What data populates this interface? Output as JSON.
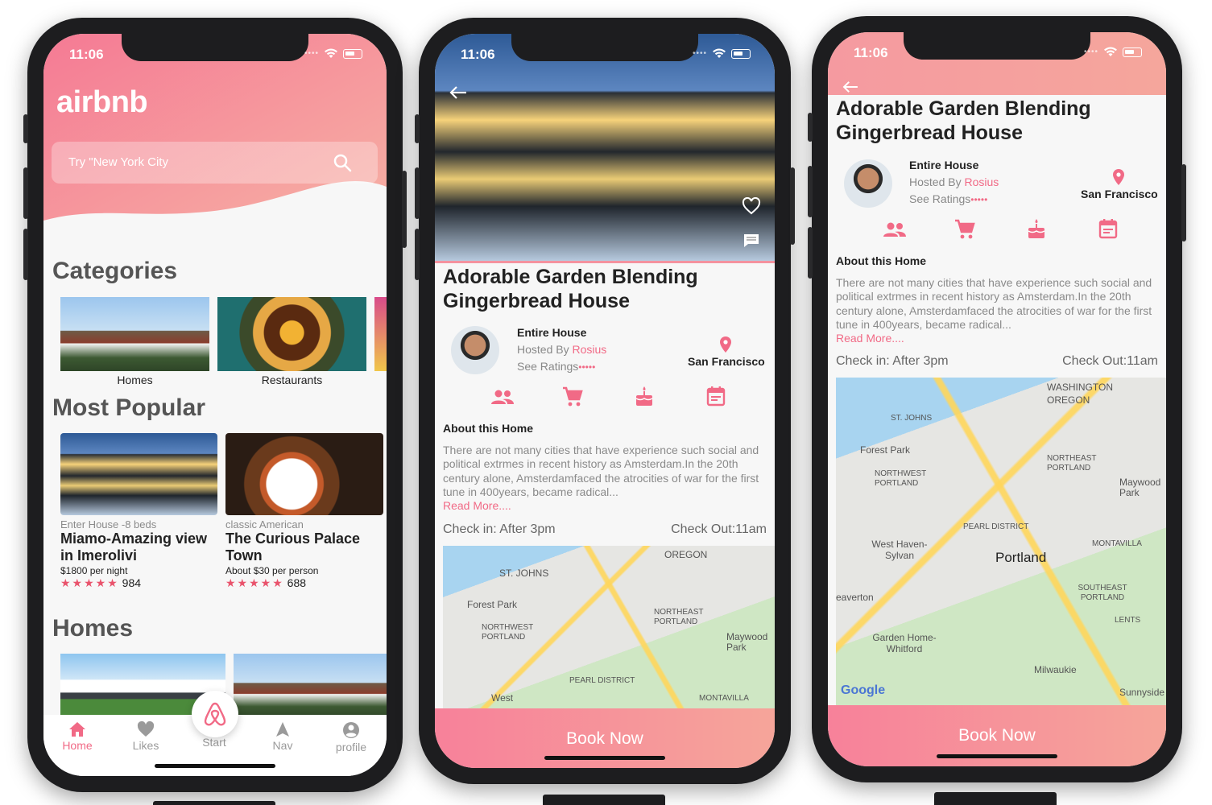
{
  "status": {
    "time": "11:06"
  },
  "screen1": {
    "brand": "airbnb",
    "search_placeholder": "Try \"New York City",
    "sections": {
      "categories": "Categories",
      "most_popular": "Most Popular",
      "homes": "Homes"
    },
    "categories": [
      {
        "label": "Homes"
      },
      {
        "label": "Restaurants"
      }
    ],
    "popular": [
      {
        "subtitle": "Enter House -8 beds",
        "title": "Miamo-Amazing view in Imerolivi",
        "price": "$1800 per night",
        "stars": "★★★★★",
        "count": "984"
      },
      {
        "subtitle": "classic American",
        "title": "The Curious Palace Town",
        "price": "About $30 per person",
        "stars": "★★★★★",
        "count": "688"
      }
    ],
    "tabs": {
      "home": "Home",
      "likes": "Likes",
      "start": "Start",
      "nav": "Nav",
      "profile": "profile"
    }
  },
  "detail": {
    "title_line1": "Adorable Garden Blending",
    "title_line2": "Gingerbread House",
    "type": "Entire House",
    "hosted_by": "Hosted By",
    "host": "Rosius",
    "see_ratings": "See Ratings",
    "rating_stars": "•••••",
    "location": "San Francisco",
    "about_heading": "About this Home",
    "about_text": "There are not many cities that have experience such social and political extrmes in recent history as Amsterdam.In the 20th century alone, Amsterdamfaced the atrocities of war for the first tune in 400years, became radical...",
    "read_more": "Read More....",
    "check_in": "Check in: After 3pm",
    "check_out": "Check Out:11am",
    "book": "Book Now"
  },
  "map_small": {
    "labels": [
      "ST. JOHNS",
      "Forest Park",
      "NORTHWEST PORTLAND",
      "OREGON",
      "NORTHEAST PORTLAND",
      "Maywood Park",
      "PEARL DISTRICT",
      "West",
      "MONTAVILLA"
    ]
  },
  "map_large": {
    "labels": [
      "WASHINGTON",
      "OREGON",
      "ST. JOHNS",
      "Forest Park",
      "NORTHWEST PORTLAND",
      "NORTHEAST PORTLAND",
      "Maywood Park",
      "PEARL DISTRICT",
      "West Haven-Sylvan",
      "Portland",
      "MONTAVILLA",
      "eaverton",
      "SOUTHEAST PORTLAND",
      "LENTS",
      "Garden Home-Whitford",
      "Milwaukie",
      "Sunnyside",
      "Google"
    ]
  },
  "theme": {
    "accent": "#f16a86",
    "gradient_start": "#f7819a",
    "gradient_end": "#f6a59a"
  }
}
